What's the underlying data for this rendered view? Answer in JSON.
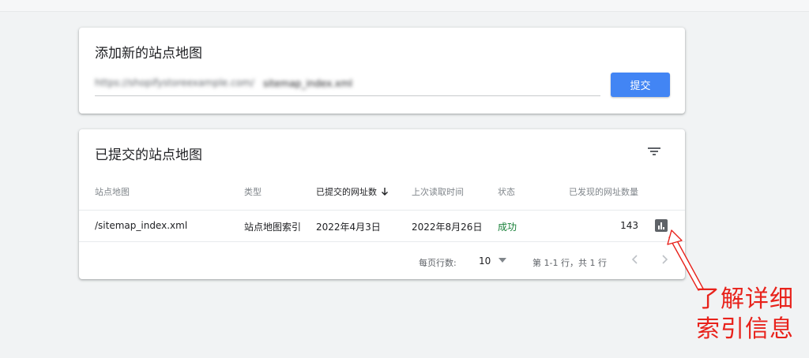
{
  "add_card": {
    "title": "添加新的站点地图",
    "url_prefix": "https://shopifystoreexample.com/",
    "url_value": "sitemap_index.xml",
    "submit_label": "提交"
  },
  "submitted_card": {
    "title": "已提交的站点地图",
    "headers": {
      "sitemap": "站点地图",
      "type": "类型",
      "submitted": "已提交的网址数",
      "last_read": "上次读取时间",
      "status": "状态",
      "discovered": "已发现的网址数量"
    },
    "rows": [
      {
        "sitemap": "/sitemap_index.xml",
        "type": "站点地图索引",
        "submitted": "2022年4月3日",
        "last_read": "2022年8月26日",
        "status": "成功",
        "discovered": "143"
      }
    ],
    "pagination": {
      "rows_per_page_label": "每页行数:",
      "rows_per_page": "10",
      "range": "第 1-1 行，共 1 行"
    }
  },
  "annotation": {
    "line1": "了解详细",
    "line2": "索引信息"
  },
  "colors": {
    "primary_button": "#4285f4",
    "status_success": "#188038",
    "annotation": "#e8221b",
    "background": "#f1f3f4"
  },
  "icons": [
    "filter-icon",
    "sort-down-icon",
    "dropdown-icon",
    "chevron-left-icon",
    "chevron-right-icon",
    "bar-chart-icon"
  ]
}
